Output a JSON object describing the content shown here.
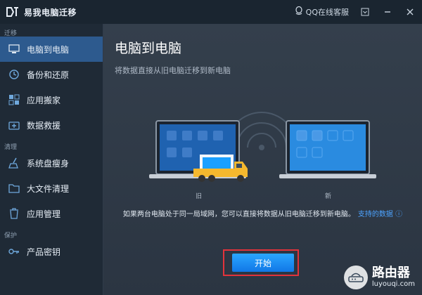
{
  "app": {
    "title": "易我电脑迁移",
    "qq_support": "QQ在线客服"
  },
  "sidebar": {
    "sections": [
      {
        "label": "迁移",
        "items": [
          {
            "label": "电脑到电脑",
            "icon": "monitor-icon",
            "active": true
          },
          {
            "label": "备份和还原",
            "icon": "backup-icon",
            "active": false
          },
          {
            "label": "应用搬家",
            "icon": "apps-icon",
            "active": false
          },
          {
            "label": "数据救援",
            "icon": "rescue-icon",
            "active": false
          }
        ]
      },
      {
        "label": "清理",
        "items": [
          {
            "label": "系统盘瘦身",
            "icon": "broom-icon",
            "active": false
          },
          {
            "label": "大文件清理",
            "icon": "folder-icon",
            "active": false
          },
          {
            "label": "应用管理",
            "icon": "trash-icon",
            "active": false
          }
        ]
      },
      {
        "label": "保护",
        "items": [
          {
            "label": "产品密钥",
            "icon": "key-icon",
            "active": false
          }
        ]
      }
    ]
  },
  "main": {
    "title": "电脑到电脑",
    "subtitle": "将数据直接从旧电脑迁移到新电脑",
    "old_label": "旧",
    "new_label": "新",
    "info_text": "如果两台电脑处于同一局域网，您可以直接将数据从旧电脑迁移到新电脑。",
    "info_link": "支持的数据",
    "start_button": "开始"
  },
  "watermark": {
    "text": "路由器",
    "sub": "luyouqi.com"
  },
  "colors": {
    "accent": "#1a8cff",
    "active_nav": "#2d5a8e",
    "highlight": "#e2333b",
    "truck": "#f5b82e"
  }
}
